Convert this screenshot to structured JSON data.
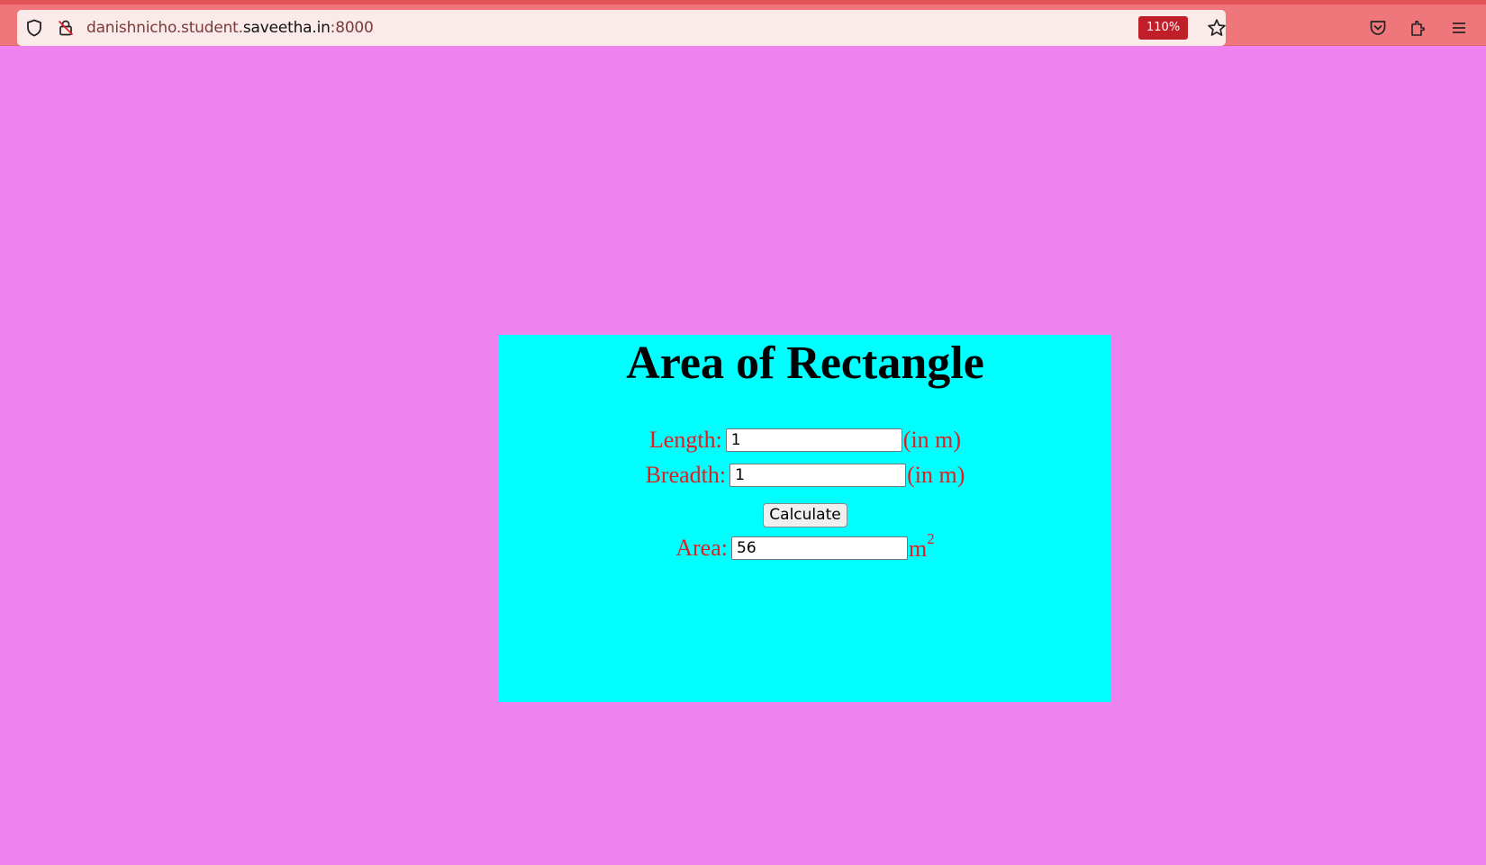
{
  "browser": {
    "url_prefix": "danishnicho.student.",
    "url_host": "saveetha.in",
    "url_port": ":8000",
    "zoom": "110%",
    "icons": [
      "shield-icon",
      "lock-off-icon",
      "star-icon",
      "pocket-icon",
      "extensions-icon",
      "menu-icon"
    ]
  },
  "page": {
    "title": "Area of Rectangle",
    "length": {
      "label": "Length:",
      "value": "1",
      "unit": "(in m)"
    },
    "breadth": {
      "label": "Breadth:",
      "value": "1",
      "unit": "(in m)"
    },
    "calculate_label": "Calculate",
    "area": {
      "label": "Area:",
      "value": "56",
      "unit": "m",
      "unit_sup": "2"
    },
    "colors": {
      "background": "#ee82ee",
      "panel": "#00ffff",
      "label": "#e02020"
    }
  }
}
